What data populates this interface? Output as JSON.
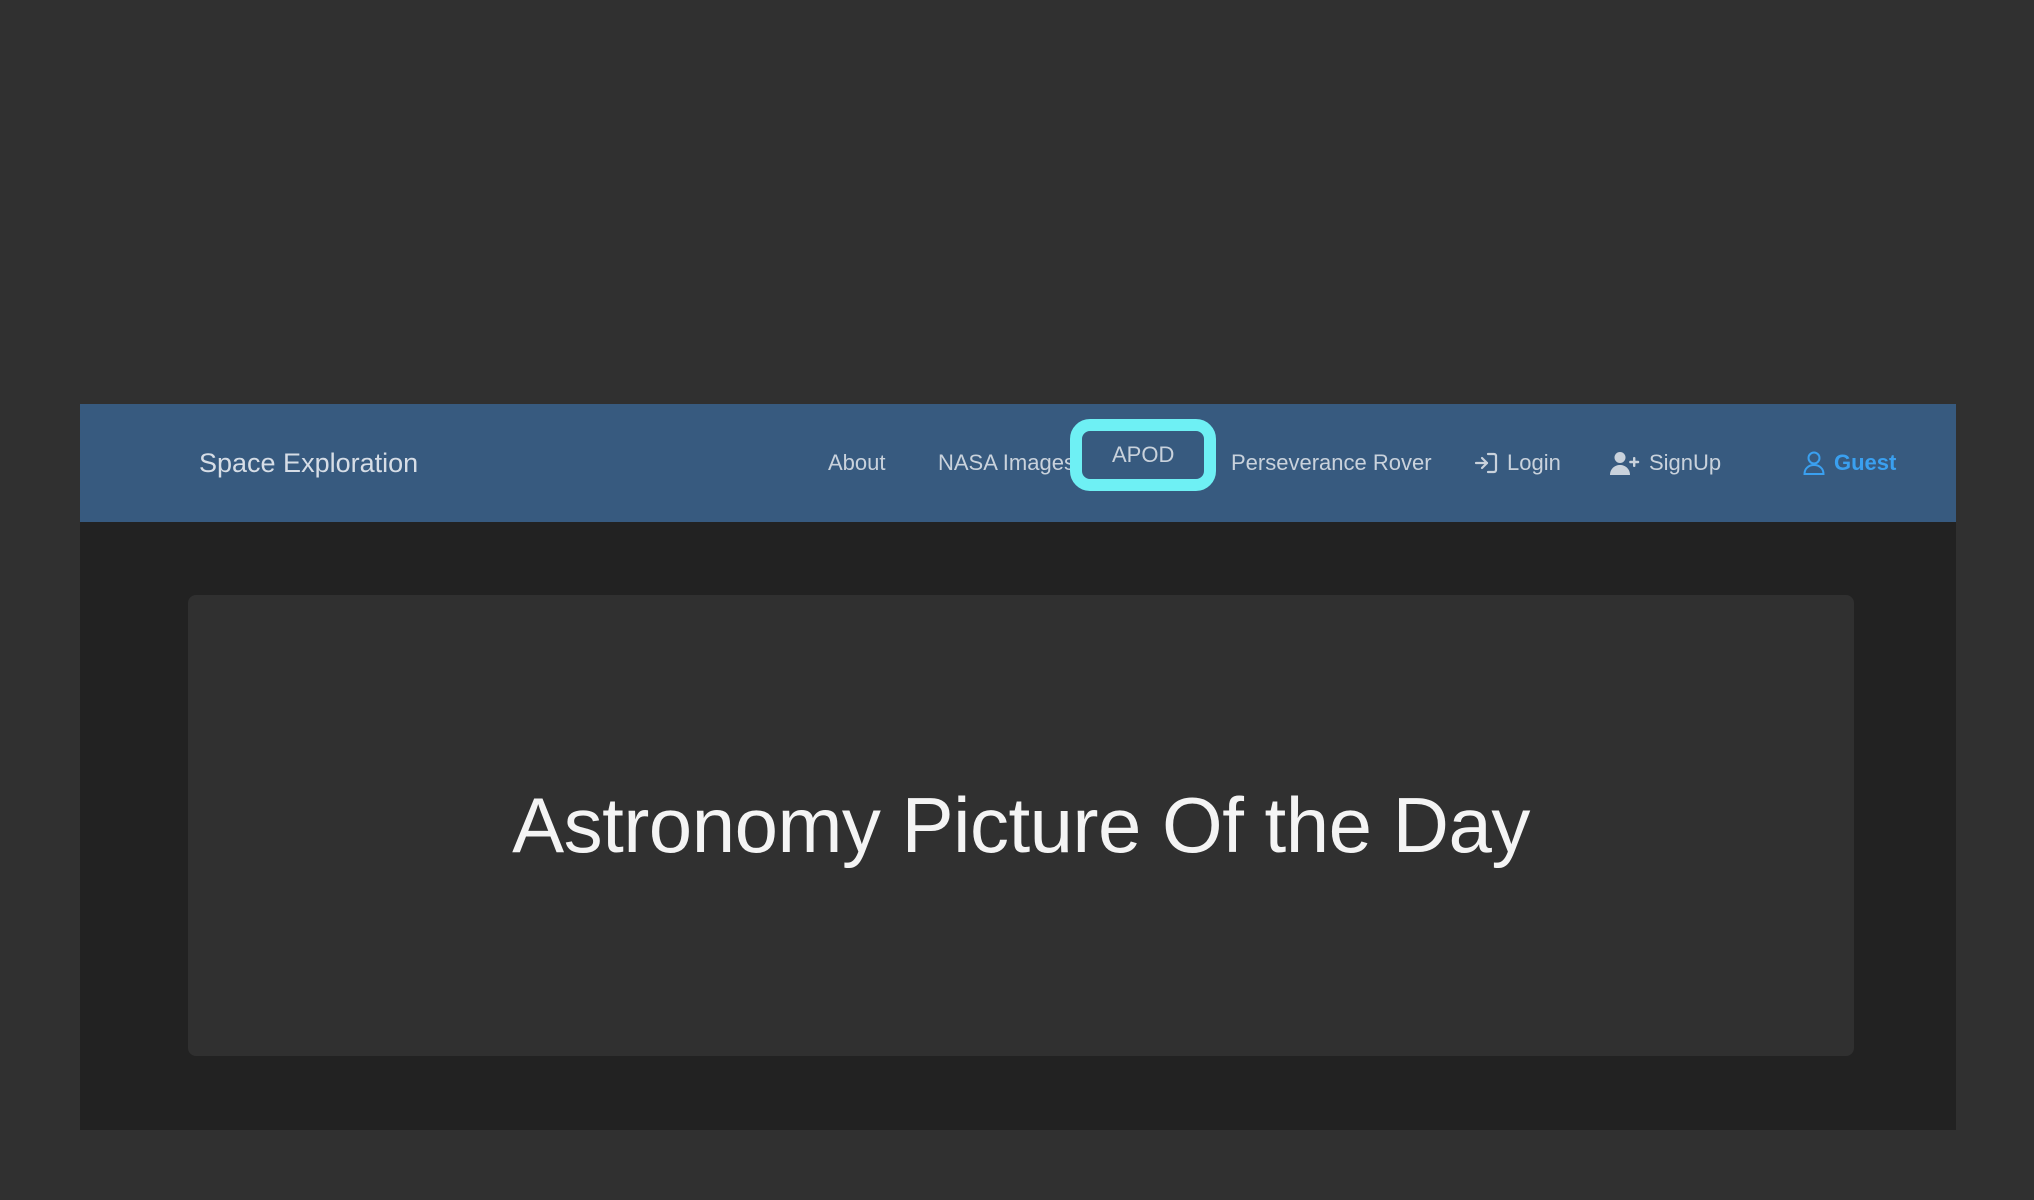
{
  "navbar": {
    "brand": "Space Exploration",
    "items": [
      {
        "label": "About"
      },
      {
        "label": "NASA Images"
      },
      {
        "label": "APOD"
      },
      {
        "label": "Perseverance Rover"
      },
      {
        "label": "Login",
        "icon": "login-icon"
      },
      {
        "label": "SignUp",
        "icon": "user-plus-icon"
      },
      {
        "label": "Guest",
        "icon": "user-icon"
      }
    ],
    "active_item": "APOD"
  },
  "jumbotron": {
    "title": "Astronomy Picture Of the Day"
  },
  "colors": {
    "page_background": "#303030",
    "content_background": "#222222",
    "navbar": "#375a7f",
    "highlight": "#6ef0f4",
    "guest_link": "#3aa0f0"
  }
}
